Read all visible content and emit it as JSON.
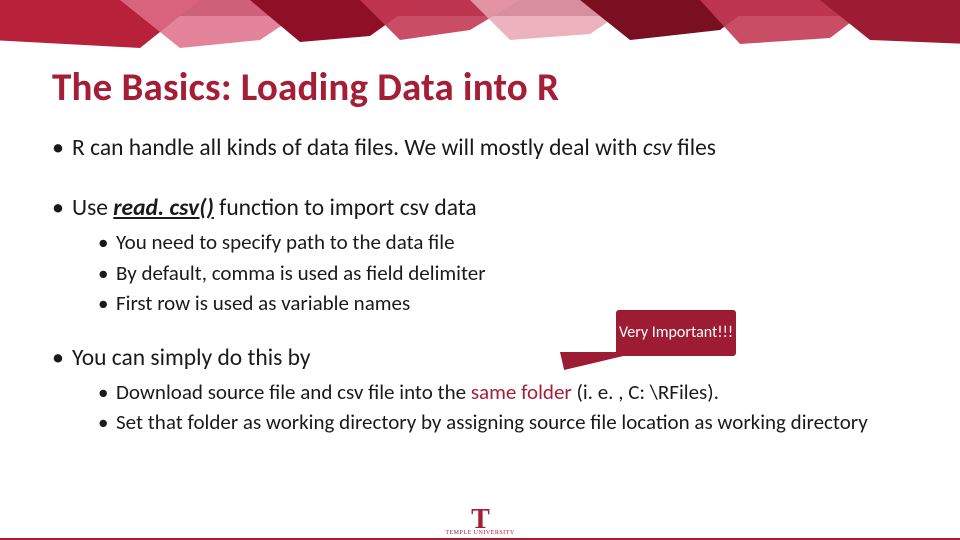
{
  "title": "The Basics: Loading Data into R",
  "bullets": {
    "b1_pre": "R can handle all kinds of data files. We will mostly deal with ",
    "b1_em": "csv",
    "b1_post": " files",
    "b2_pre": "Use ",
    "b2_fn": "read. csv()",
    "b2_post": " function to import csv data",
    "b2_sub": [
      "You need to specify path to the data file",
      "By default, comma is used as field delimiter",
      "First row is used as variable names"
    ],
    "b3": " You can simply do this by",
    "b3_sub1_pre": "Download source file and csv file into the ",
    "b3_sub1_hl": "same folder",
    "b3_sub1_post": " (i. e. , C: \\RFiles).",
    "b3_sub2": "Set that folder as working directory by assigning source file location as working directory"
  },
  "callout": "Very Important!!!",
  "logo": {
    "mark": "T",
    "word": "TEMPLE UNIVERSITY"
  }
}
